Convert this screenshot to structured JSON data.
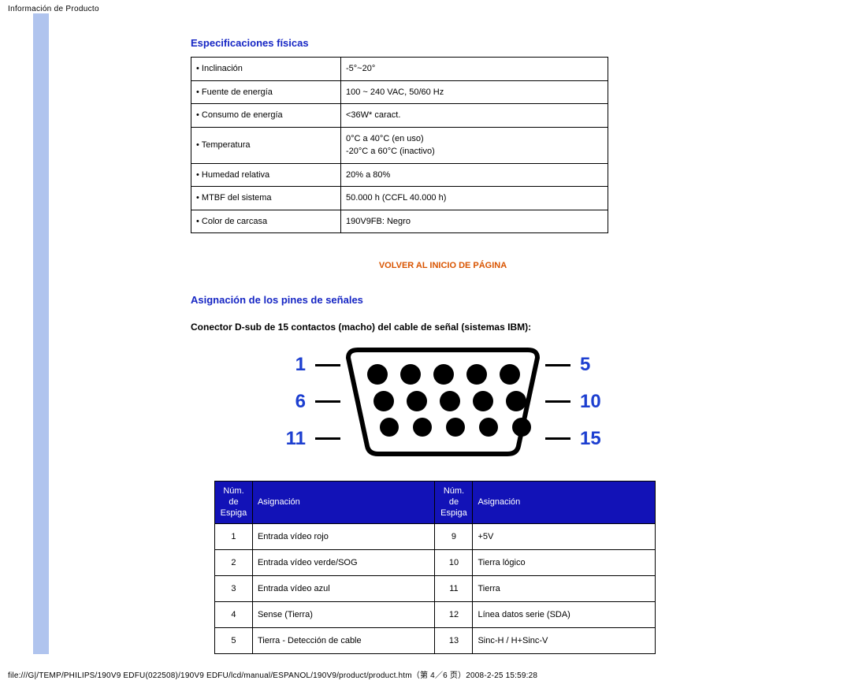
{
  "header_small": "Información de Producto",
  "section1_title": "Especificaciones físicas",
  "spec_rows": [
    {
      "label": "Inclinación",
      "value": "-5°~20°"
    },
    {
      "label": "Fuente de energía",
      "value": "100 ~ 240 VAC, 50/60 Hz"
    },
    {
      "label": "Consumo de energía",
      "value": "<36W* caract."
    },
    {
      "label": "Temperatura",
      "value": "0°C a 40°C (en uso)\n-20°C a 60°C (inactivo)"
    },
    {
      "label": "Humedad relativa",
      "value": "20% a 80%"
    },
    {
      "label": "MTBF del sistema",
      "value": "50.000 h (CCFL 40.000 h)"
    },
    {
      "label": "Color de carcasa",
      "value": "190V9FB: Negro\n "
    }
  ],
  "back_top": "VOLVER AL INICIO DE PÁGINA",
  "section2_title": "Asignación de los pines de señales",
  "connector_text": "Conector D-sub de 15 contactos (macho) del cable de señal (sistemas IBM):",
  "diagram_numbers": {
    "left": [
      "1",
      "6",
      "11"
    ],
    "right": [
      "5",
      "10",
      "15"
    ]
  },
  "pin_headers": {
    "num": "Núm. de Espiga",
    "assign": "Asignación"
  },
  "pin_rows": [
    {
      "l_n": "1",
      "l_a": "Entrada vídeo rojo",
      "r_n": "9",
      "r_a": "+5V"
    },
    {
      "l_n": "2",
      "l_a": "Entrada vídeo verde/SOG",
      "r_n": "10",
      "r_a": "Tierra lógico"
    },
    {
      "l_n": "3",
      "l_a": "Entrada vídeo azul",
      "r_n": "11",
      "r_a": "Tierra"
    },
    {
      "l_n": "4",
      "l_a": "Sense (Tierra)",
      "r_n": "12",
      "r_a": "Línea datos serie (SDA)"
    },
    {
      "l_n": "5",
      "l_a": "Tierra - Detección de cable",
      "r_n": "13",
      "r_a": "Sinc-H / H+Sinc-V"
    }
  ],
  "footer": "file:///G|/TEMP/PHILIPS/190V9 EDFU(022508)/190V9 EDFU/lcd/manual/ESPANOL/190V9/product/product.htm（第 4／6 页）2008-2-25 15:59:28"
}
